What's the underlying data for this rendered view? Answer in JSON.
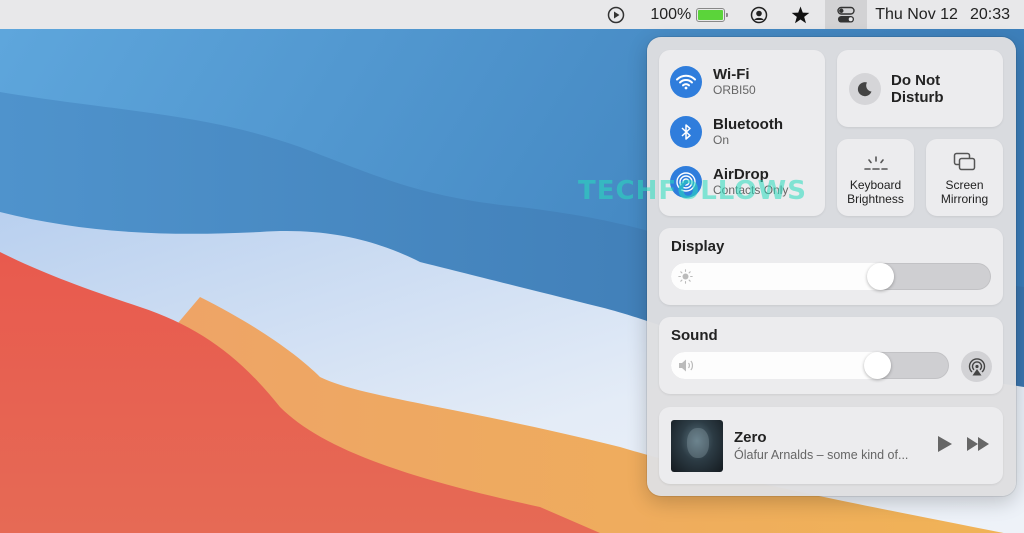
{
  "menubar": {
    "battery_percent": "100%",
    "battery_level": 1.0,
    "date": "Thu Nov 12",
    "time": "20:33",
    "icons": [
      "play-circle-icon",
      "battery-icon",
      "user-circle-icon",
      "star-icon",
      "control-center-icon"
    ]
  },
  "control_center": {
    "wifi": {
      "title": "Wi-Fi",
      "subtitle": "ORBI50",
      "icon": "wifi-icon",
      "active": true
    },
    "bluetooth": {
      "title": "Bluetooth",
      "subtitle": "On",
      "icon": "bluetooth-icon",
      "active": true
    },
    "airdrop": {
      "title": "AirDrop",
      "subtitle": "Contacts Only",
      "icon": "airdrop-icon",
      "active": true
    },
    "do_not_disturb": {
      "title_line1": "Do Not",
      "title_line2": "Disturb",
      "icon": "moon-icon"
    },
    "keyboard_brightness": {
      "line1": "Keyboard",
      "line2": "Brightness",
      "icon": "keyboard-brightness-icon"
    },
    "screen_mirroring": {
      "line1": "Screen",
      "line2": "Mirroring",
      "icon": "screen-mirroring-icon"
    },
    "display": {
      "label": "Display",
      "level": 0.67
    },
    "sound": {
      "label": "Sound",
      "level": 0.77
    },
    "now_playing": {
      "title": "Zero",
      "subtitle": "Ólafur Arnalds – some kind of..."
    }
  },
  "colors": {
    "accent": "#2f7ddc",
    "battery": "#5bd43a"
  },
  "watermark": "TECHFOLLOWS"
}
